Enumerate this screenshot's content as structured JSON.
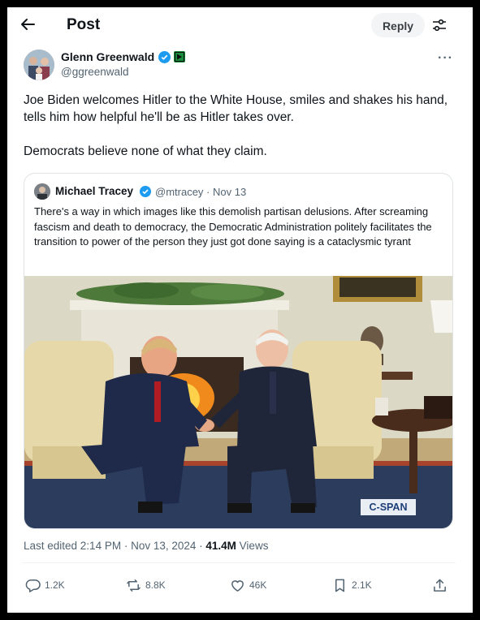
{
  "header": {
    "title": "Post",
    "reply_label": "Reply"
  },
  "tweet": {
    "author_name": "Glenn Greenwald",
    "author_handle": "@ggreenwald",
    "text_1": "Joe Biden welcomes Hitler to the White House, smiles and shakes his hand, tells him how helpful he'll be as Hitler takes over.",
    "text_2": "Democrats believe none of what they claim."
  },
  "quote": {
    "author_name": "Michael Tracey",
    "meta": "@mtracey · Nov 13",
    "text": "There's a way in which images like this demolish partisan delusions. After screaming fascism and death to democracy, the Democratic Administration politely facilitates the transition to power of the person they just got done saying is a cataclysmic tyrant",
    "image_watermark": "C-SPAN"
  },
  "meta": {
    "edited": "Last edited 2:14 PM · Nov 13, 2024 · ",
    "views_count": "41.4M",
    "views_label": " Views"
  },
  "actions": {
    "replies": "1.2K",
    "reposts": "8.8K",
    "likes": "46K",
    "bookmarks": "2.1K"
  },
  "icons": [
    "back-arrow-icon",
    "tune-icon",
    "verified-icon",
    "subscriber-badge-icon",
    "more-icon",
    "reply-icon",
    "repost-icon",
    "like-icon",
    "bookmark-icon",
    "share-icon"
  ],
  "colors": {
    "verified": "#1d9bf0",
    "muted": "#536471",
    "text": "#0f1419"
  }
}
